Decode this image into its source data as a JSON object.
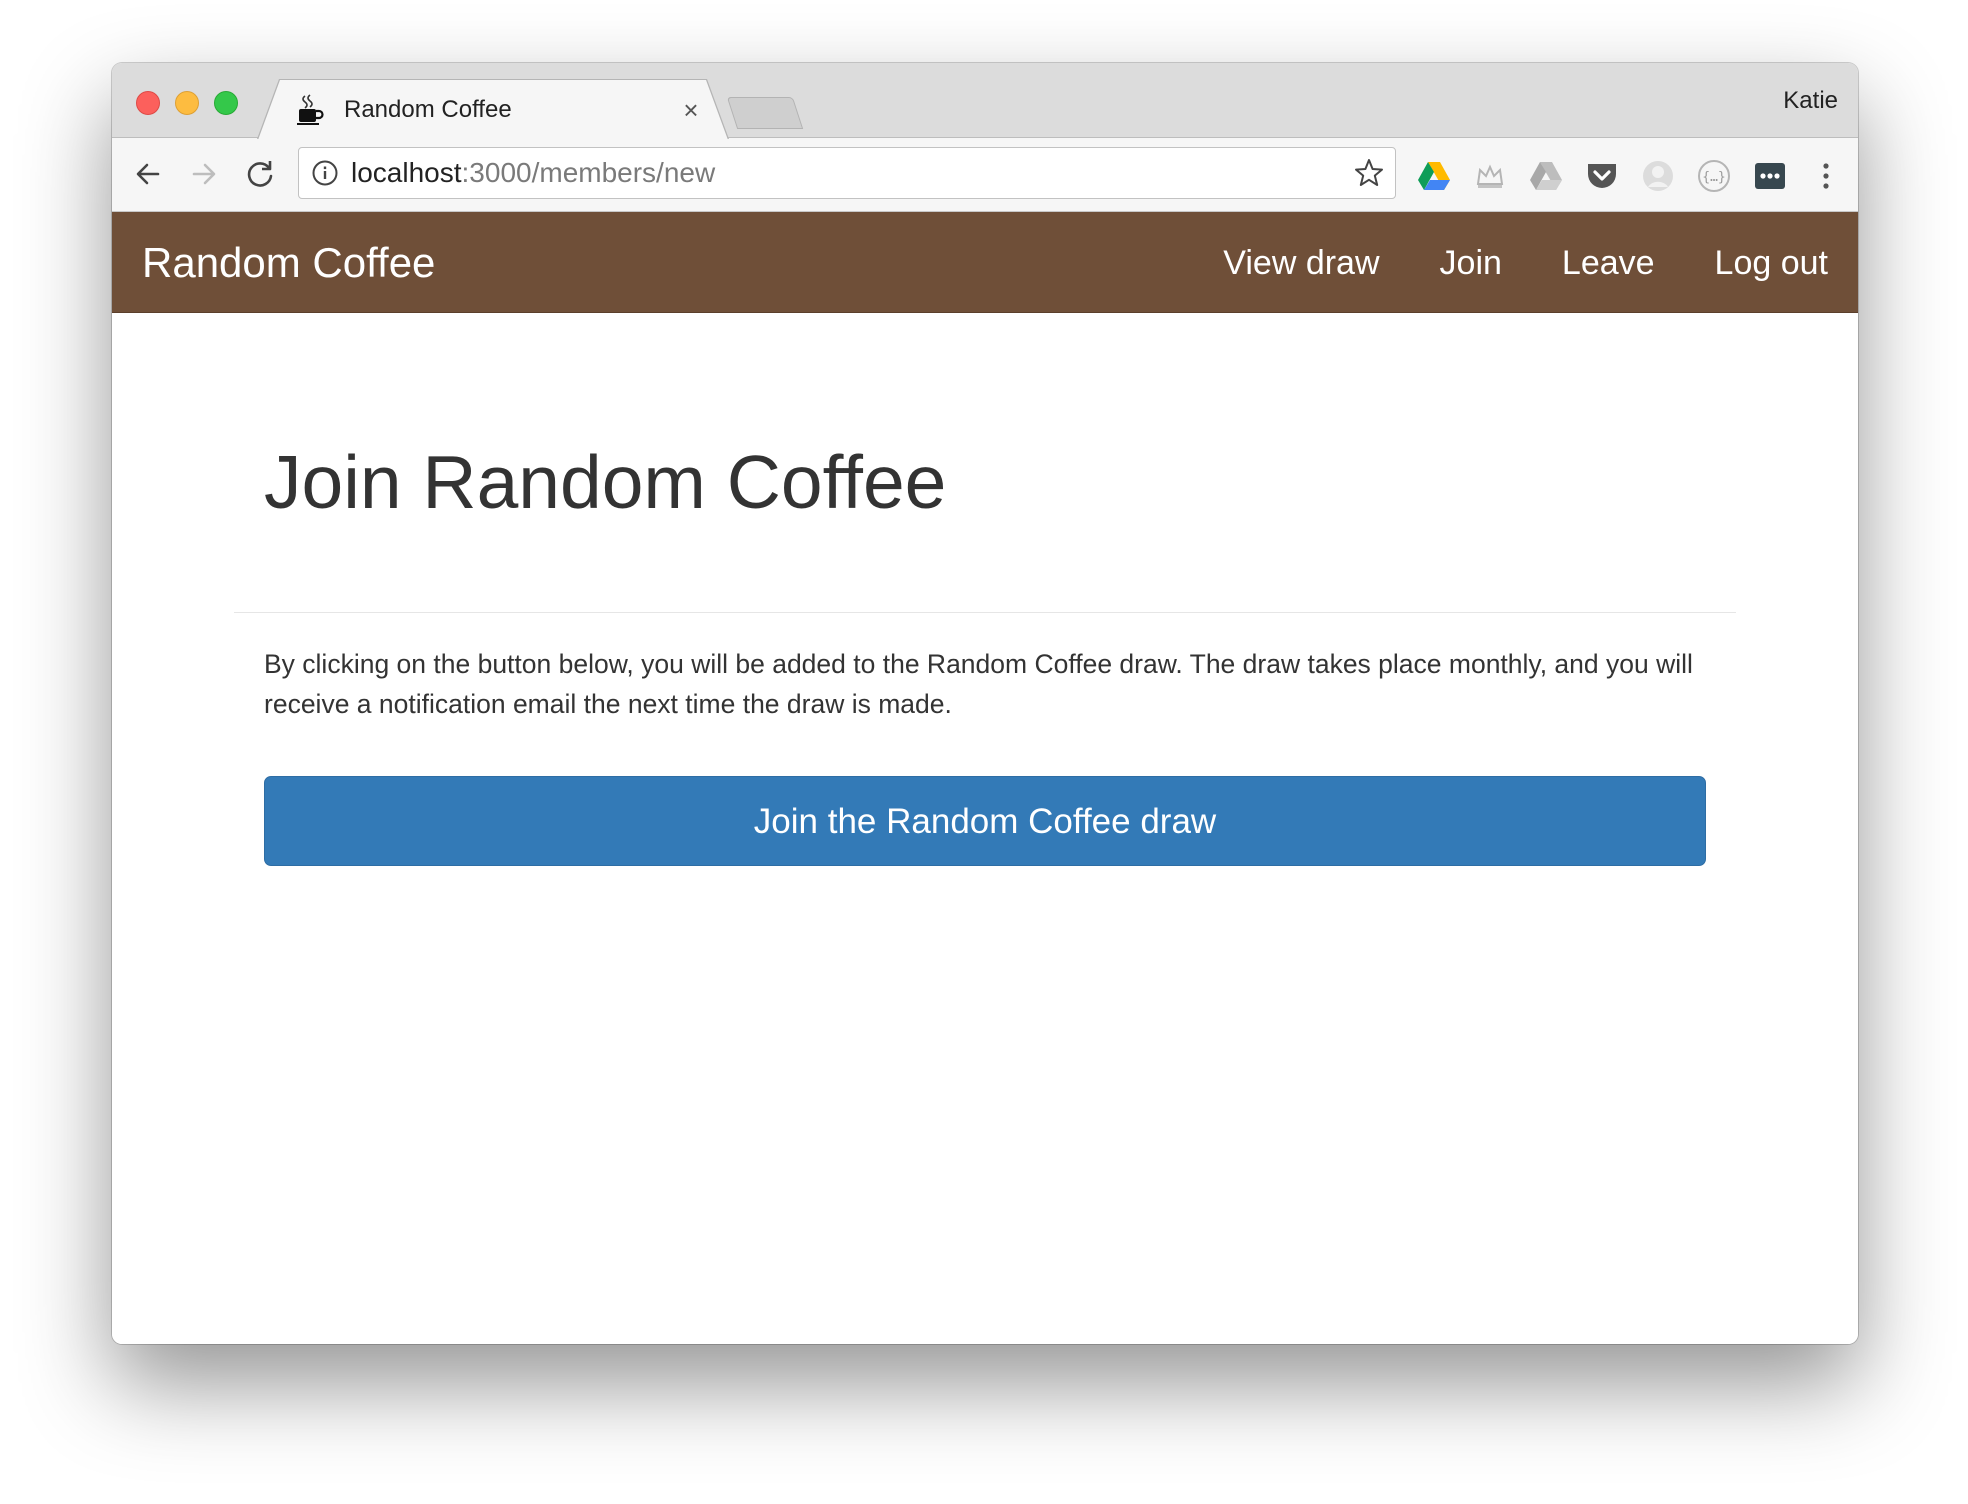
{
  "browser": {
    "tab_title": "Random Coffee",
    "tab_close": "×",
    "profile_name": "Katie",
    "url_host": "localhost",
    "url_path": ":3000/members/new",
    "icons": {
      "favicon": "coffee-cup-icon",
      "back": "arrow-left-icon",
      "forward": "arrow-right-icon",
      "reload": "reload-icon",
      "info": "info-icon",
      "bookmark": "star-icon",
      "menu": "kebab-menu-icon"
    },
    "extensions": [
      "google-drive-icon",
      "crown-icon",
      "drive-grey-icon",
      "pocket-icon",
      "avatar-ext-icon",
      "json-ext-icon",
      "dots-ext-icon"
    ]
  },
  "navbar": {
    "brand": "Random Coffee",
    "links": [
      "View draw",
      "Join",
      "Leave",
      "Log out"
    ],
    "color": "#6f4f38"
  },
  "main": {
    "heading": "Join Random Coffee",
    "description": "By clicking on the button below, you will be added to the Random Coffee draw. The draw takes place monthly, and you will receive a notification email the next time the draw is made.",
    "button_label": "Join the Random Coffee draw",
    "button_color": "#337ab7"
  }
}
